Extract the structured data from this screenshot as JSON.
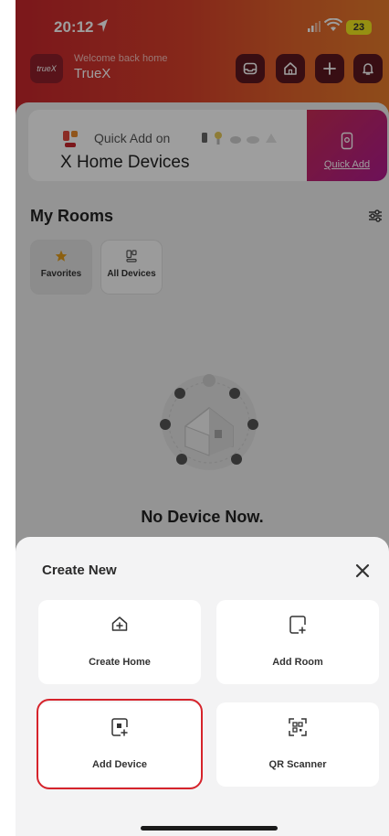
{
  "status_bar": {
    "time": "20:12",
    "battery": "23"
  },
  "header": {
    "logo": "trueX",
    "welcome": "Welcome back home",
    "brand": "TrueX",
    "actions": [
      "inbox-icon",
      "home-icon",
      "plus-icon",
      "bell-icon"
    ]
  },
  "quick_add": {
    "prefix": "Quick Add on",
    "title": "X Home Devices",
    "button_label": "Quick Add"
  },
  "rooms": {
    "title": "My Rooms",
    "tabs": [
      {
        "label": "Favorites",
        "icon": "star-icon"
      },
      {
        "label": "All Devices",
        "icon": "devices-icon"
      }
    ]
  },
  "empty_state": {
    "text": "No Device Now."
  },
  "sheet": {
    "title": "Create New",
    "options": [
      {
        "label": "Create Home",
        "icon": "home-plus-icon"
      },
      {
        "label": "Add Room",
        "icon": "room-plus-icon"
      },
      {
        "label": "Add Device",
        "icon": "device-plus-icon",
        "highlighted": true
      },
      {
        "label": "QR Scanner",
        "icon": "qr-scan-icon"
      }
    ]
  },
  "colors": {
    "header_start": "#c7262d",
    "header_end": "#e77b2b",
    "highlight": "#d6232b",
    "accent_gradient": "#b01b8f",
    "star": "#e39b1b"
  }
}
